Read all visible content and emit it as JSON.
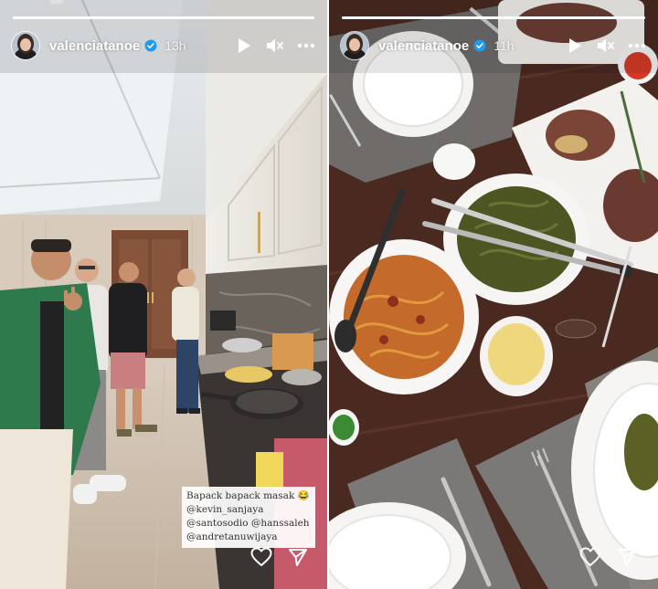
{
  "stories": [
    {
      "username": "valenciatanoe",
      "time_ago": "13h",
      "progress_fraction": 1.0,
      "caption_lines": [
        "Bapack bapack masak 😂",
        "@kevin_sanjaya",
        "@santosodio @hanssaleh",
        "@andretanuwijaya"
      ],
      "icons": [
        "play-icon",
        "mute-icon",
        "more-icon",
        "heart-icon",
        "send-icon"
      ]
    },
    {
      "username": "valenciatanoe",
      "time_ago": "11h",
      "progress_fraction": 1.0,
      "icons": [
        "play-icon",
        "mute-icon",
        "more-icon",
        "heart-icon",
        "send-icon"
      ]
    }
  ],
  "colors": {
    "verified_badge": "#1d9bf0",
    "header_text": "#ffffff",
    "caption_bg": "#ffffff"
  }
}
